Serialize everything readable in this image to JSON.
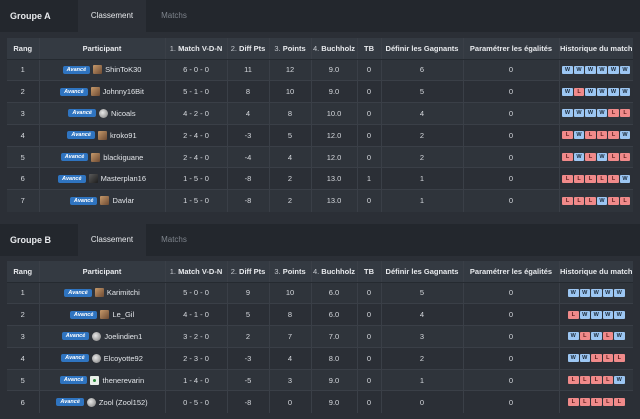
{
  "colors": {
    "win": "#9cc6f2",
    "loss": "#f08a8a",
    "badge": "#2f74c0"
  },
  "columns": {
    "rank": "Rang",
    "participant": "Participant",
    "match_num": "1.",
    "match": "Match V-D-N",
    "diff_num": "2.",
    "diff": "Diff Pts",
    "points_num": "3.",
    "points": "Points",
    "buchholz_num": "4.",
    "buchholz": "Buchholz",
    "tb": "TB",
    "winners": "Définir les Gagnants",
    "ties": "Paramétrer les égalités",
    "history": "Historique du match"
  },
  "groups": [
    {
      "title": "Groupe A",
      "tabs": [
        "Classement",
        "Matchs"
      ],
      "rows": [
        {
          "rank": "1",
          "badge": "Avancé",
          "avatar": "photo",
          "name": "ShinToK30",
          "match": "6 - 0 - 0",
          "diff": "11",
          "points": "12",
          "buchholz": "9.0",
          "tb": "0",
          "winners": "6",
          "ties": "0",
          "history": [
            "W",
            "W",
            "W",
            "W",
            "W",
            "W"
          ]
        },
        {
          "rank": "2",
          "badge": "Avancé",
          "avatar": "photo",
          "name": "Johnny16Bit",
          "match": "5 - 1 - 0",
          "diff": "8",
          "points": "10",
          "buchholz": "9.0",
          "tb": "0",
          "winners": "5",
          "ties": "0",
          "history": [
            "W",
            "L",
            "W",
            "W",
            "W",
            "W"
          ]
        },
        {
          "rank": "3",
          "badge": "Avancé",
          "avatar": "round",
          "name": "Nicoals",
          "match": "4 - 2 - 0",
          "diff": "4",
          "points": "8",
          "buchholz": "10.0",
          "tb": "0",
          "winners": "4",
          "ties": "0",
          "history": [
            "W",
            "W",
            "W",
            "W",
            "L",
            "L"
          ]
        },
        {
          "rank": "4",
          "badge": "Avancé",
          "avatar": "photo",
          "name": "kroko91",
          "match": "2 - 4 - 0",
          "diff": "-3",
          "points": "5",
          "buchholz": "12.0",
          "tb": "0",
          "winners": "2",
          "ties": "0",
          "history": [
            "L",
            "W",
            "L",
            "L",
            "L",
            "W"
          ]
        },
        {
          "rank": "5",
          "badge": "Avancé",
          "avatar": "photo",
          "name": "blackiguane",
          "match": "2 - 4 - 0",
          "diff": "-4",
          "points": "4",
          "buchholz": "12.0",
          "tb": "0",
          "winners": "2",
          "ties": "0",
          "history": [
            "L",
            "W",
            "L",
            "W",
            "L",
            "L"
          ]
        },
        {
          "rank": "6",
          "badge": "Avancé",
          "avatar": "dark",
          "name": "Masterplan16",
          "match": "1 - 5 - 0",
          "diff": "-8",
          "points": "2",
          "buchholz": "13.0",
          "tb": "1",
          "winners": "1",
          "ties": "0",
          "history": [
            "L",
            "L",
            "L",
            "L",
            "L",
            "W"
          ]
        },
        {
          "rank": "7",
          "badge": "Avancé",
          "avatar": "photo",
          "name": "Davlar",
          "match": "1 - 5 - 0",
          "diff": "-8",
          "points": "2",
          "buchholz": "13.0",
          "tb": "0",
          "winners": "1",
          "ties": "0",
          "history": [
            "L",
            "L",
            "L",
            "W",
            "L",
            "L"
          ]
        }
      ]
    },
    {
      "title": "Groupe B",
      "tabs": [
        "Classement",
        "Matchs"
      ],
      "rows": [
        {
          "rank": "1",
          "badge": "Avancé",
          "avatar": "photo",
          "name": "Karimitchi",
          "match": "5 - 0 - 0",
          "diff": "9",
          "points": "10",
          "buchholz": "6.0",
          "tb": "0",
          "winners": "5",
          "ties": "0",
          "history": [
            "W",
            "W",
            "W",
            "W",
            "W"
          ]
        },
        {
          "rank": "2",
          "badge": "Avancé",
          "avatar": "photo",
          "name": "Le_Gil",
          "match": "4 - 1 - 0",
          "diff": "5",
          "points": "8",
          "buchholz": "6.0",
          "tb": "0",
          "winners": "4",
          "ties": "0",
          "history": [
            "L",
            "W",
            "W",
            "W",
            "W"
          ]
        },
        {
          "rank": "3",
          "badge": "Avancé",
          "avatar": "round",
          "name": "Joelindien1",
          "match": "3 - 2 - 0",
          "diff": "2",
          "points": "7",
          "buchholz": "7.0",
          "tb": "0",
          "winners": "3",
          "ties": "0",
          "history": [
            "W",
            "L",
            "W",
            "L",
            "W"
          ]
        },
        {
          "rank": "4",
          "badge": "Avancé",
          "avatar": "round",
          "name": "Elcoyotte92",
          "match": "2 - 3 - 0",
          "diff": "-3",
          "points": "4",
          "buchholz": "8.0",
          "tb": "0",
          "winners": "2",
          "ties": "0",
          "history": [
            "W",
            "W",
            "L",
            "L",
            "L"
          ]
        },
        {
          "rank": "5",
          "badge": "Avancé",
          "avatar": "white",
          "name": "thenerevarin",
          "match": "1 - 4 - 0",
          "diff": "-5",
          "points": "3",
          "buchholz": "9.0",
          "tb": "0",
          "winners": "1",
          "ties": "0",
          "history": [
            "L",
            "L",
            "L",
            "L",
            "W"
          ]
        },
        {
          "rank": "6",
          "badge": "Avancé",
          "avatar": "round",
          "name": "Zool (Zool152)",
          "match": "0 - 5 - 0",
          "diff": "-8",
          "points": "0",
          "buchholz": "9.0",
          "tb": "0",
          "winners": "0",
          "ties": "0",
          "history": [
            "L",
            "L",
            "L",
            "L",
            "L"
          ]
        }
      ]
    }
  ]
}
